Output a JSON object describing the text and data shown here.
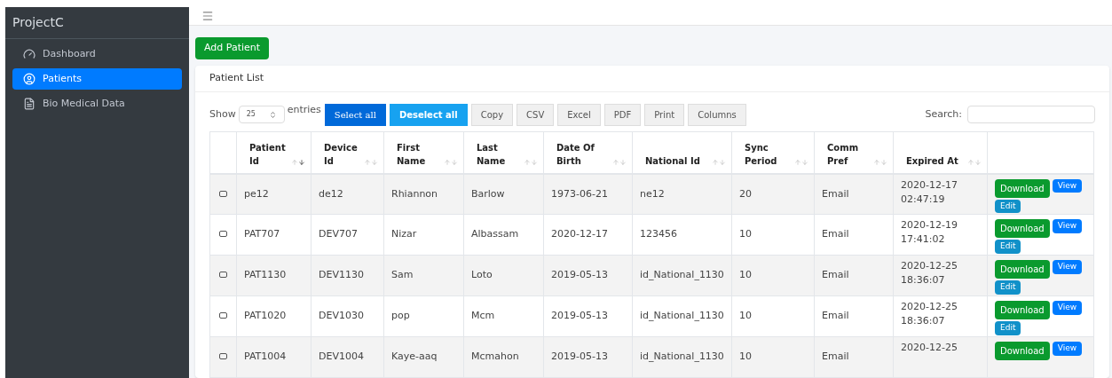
{
  "sidebar": {
    "brand": "ProjectC",
    "items": [
      {
        "label": "Dashboard",
        "selected": false
      },
      {
        "label": "Patients",
        "selected": true
      },
      {
        "label": "Bio Medical Data",
        "selected": false
      }
    ]
  },
  "add_button": "Add Patient",
  "card": {
    "title": "Patient List",
    "length": {
      "show": "Show",
      "value": "25",
      "entries": "entries"
    },
    "buttons": [
      {
        "label": "Select all",
        "kind": "primary"
      },
      {
        "label": "Deselect all",
        "kind": "info"
      },
      {
        "label": "Copy",
        "kind": "plain"
      },
      {
        "label": "CSV",
        "kind": "plain"
      },
      {
        "label": "Excel",
        "kind": "plain"
      },
      {
        "label": "PDF",
        "kind": "plain"
      },
      {
        "label": "Print",
        "kind": "plain"
      },
      {
        "label": "Columns",
        "kind": "plain"
      }
    ],
    "search_label": "Search:",
    "columns": [
      {
        "label": "Patient Id",
        "sorted": true
      },
      {
        "label": "Device Id",
        "sorted": false
      },
      {
        "label": "First Name",
        "sorted": false
      },
      {
        "label": "Last Name",
        "sorted": false
      },
      {
        "label": "Date Of Birth",
        "sorted": false
      },
      {
        "label": "National Id",
        "sorted": false
      },
      {
        "label": "Sync Period",
        "sorted": false
      },
      {
        "label": "Comm Pref",
        "sorted": false
      },
      {
        "label": "Expired At",
        "sorted": false
      }
    ],
    "rows": [
      {
        "checked": false,
        "cells": [
          "pe12",
          "de12",
          "Rhiannon",
          "Barlow",
          "1973-06-21",
          "ne12",
          "20",
          "Email"
        ],
        "expired": [
          "2020-12-17",
          "02:47:19"
        ],
        "actions": [
          "Download",
          "View",
          "Edit"
        ]
      },
      {
        "checked": false,
        "cells": [
          "PAT707",
          "DEV707",
          "Nizar",
          "Albassam",
          "2020-12-17",
          "123456",
          "10",
          "Email"
        ],
        "expired": [
          "2020-12-19",
          "17:41:02"
        ],
        "actions": [
          "Download",
          "View",
          "Edit"
        ]
      },
      {
        "checked": false,
        "cells": [
          "PAT1130",
          "DEV1130",
          "Sam",
          "Loto",
          "2019-05-13",
          "id_National_1130",
          "10",
          "Email"
        ],
        "expired": [
          "2020-12-25",
          "18:36:07"
        ],
        "actions": [
          "Download",
          "View",
          "Edit"
        ]
      },
      {
        "checked": false,
        "cells": [
          "PAT1020",
          "DEV1030",
          "pop",
          "Mcm",
          "2019-05-13",
          "id_National_1130",
          "10",
          "Email"
        ],
        "expired": [
          "2020-12-25",
          "18:36:07"
        ],
        "actions": [
          "Download",
          "View",
          "Edit"
        ]
      },
      {
        "checked": false,
        "cells": [
          "PAT1004",
          "DEV1004",
          "Kaye-aaq",
          "Mcmahon",
          "2019-05-13",
          "id_National_1130",
          "10",
          "Email"
        ],
        "expired": [
          "2020-12-25"
        ],
        "actions": [
          "Download",
          "View"
        ]
      }
    ]
  }
}
